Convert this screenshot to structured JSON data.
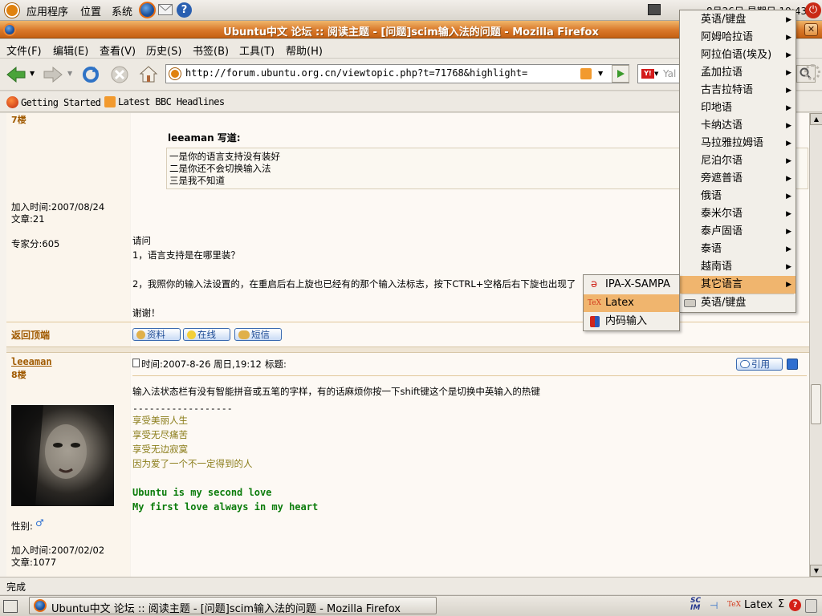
{
  "top_panel": {
    "menus": [
      "应用程序",
      "位置",
      "系统"
    ],
    "clock": "8月26日 星期日 19:43"
  },
  "window": {
    "title": "Ubuntu中文 论坛 :: 阅读主题 - [问题]scim输入法的问题 - Mozilla Firefox"
  },
  "menubar": [
    "文件(F)",
    "编辑(E)",
    "查看(V)",
    "历史(S)",
    "书签(B)",
    "工具(T)",
    "帮助(H)"
  ],
  "navbar": {
    "url": "http://forum.ubuntu.org.cn/viewtopic.php?t=71768&highlight=",
    "search_placeholder": "Yal"
  },
  "bookmarks": [
    "Getting Started",
    "Latest BBC Headlines"
  ],
  "post1": {
    "floor": "7楼",
    "join_date": "加入时间:2007/08/24",
    "articles": "文章:21",
    "expert_score": "专家分:605",
    "quote_author": "leeaman 写道:",
    "quote_lines": [
      "一是你的语言支持没有装好",
      "二是你还不会切换输入法",
      "三是我不知道"
    ],
    "body_lines": [
      "请问",
      "1，语言支持是在哪里装？",
      "2，我照你的输入法设置的，在重启后右上旋也已经有的那个输入法标志，按下CTRL+空格后右下旋也出现了",
      "谢谢！"
    ],
    "back_to_top": "返回顶端",
    "buttons": [
      "资料",
      "在线",
      "短信"
    ]
  },
  "post2": {
    "author": "leeaman",
    "floor": "8楼",
    "time": "时间:2007-8-26 周日,19:12",
    "subject_label": "标题:",
    "quote_button": "引用",
    "body": "输入法状态栏有没有智能拼音或五笔的字样，有的话麻烦你按一下shift键这个是切换中英输入的热键",
    "separator": "------------------",
    "signature_lines": [
      "享受美丽人生",
      "享受无尽痛苦",
      "享受无边寂寞",
      "因为爱了一个不一定得到的人"
    ],
    "signature_en": [
      "Ubuntu is my second love",
      "My first love always in my heart"
    ],
    "gender": "性别:",
    "join_date": "加入时间:2007/02/02",
    "articles": "文章:1077"
  },
  "statusbar": {
    "text": "完成"
  },
  "taskbar": {
    "window_button": "Ubuntu中文 论坛 :: 阅读主题 - [问题]scim输入法的问题 - Mozilla Firefox",
    "scim_label": "Latex",
    "scim_symbol": "Σ"
  },
  "language_menu": {
    "items": [
      "英语/键盘",
      "阿姆哈拉语",
      "阿拉伯语(埃及)",
      "孟加拉语",
      "古吉拉特语",
      "印地语",
      "卡纳达语",
      "马拉雅拉姆语",
      "尼泊尔语",
      "旁遮普语",
      "俄语",
      "泰米尔语",
      "泰卢固语",
      "泰语",
      "越南语",
      "其它语言",
      "英语/键盘"
    ],
    "highlighted_index": 15,
    "highlight_color": "#f0b56e"
  },
  "sub_menu": {
    "items": [
      "IPA-X-SAMPA",
      "Latex",
      "内码输入"
    ],
    "highlighted_index": 1
  },
  "colors": {
    "titlebar": "#d9782a",
    "link_orange": "#a05a00",
    "signature_olive": "#8b7d1a",
    "signature_green": "#0b7c0b"
  }
}
